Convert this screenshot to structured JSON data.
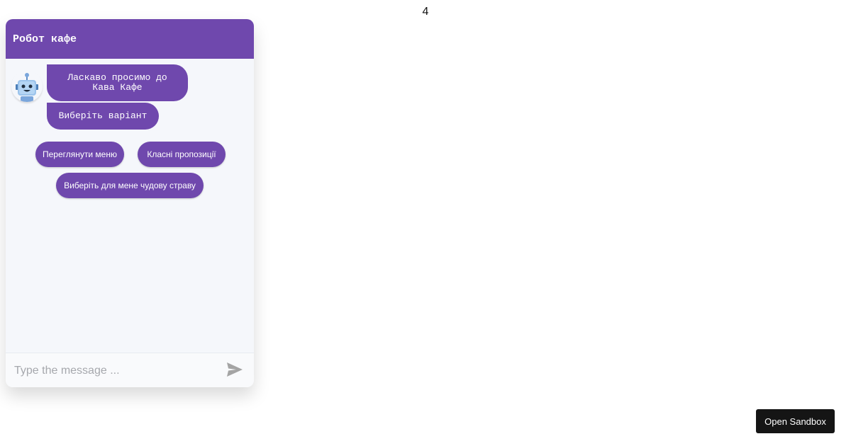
{
  "page": {
    "counter": "4"
  },
  "chat": {
    "title": "Робот кафе",
    "messages": [
      {
        "sender": "bot",
        "text": "Ласкаво просимо до Кава Кафе"
      },
      {
        "sender": "bot",
        "text": "Виберіть варіант"
      }
    ],
    "options": [
      {
        "label": "Переглянути меню"
      },
      {
        "label": "Класні пропозиції"
      },
      {
        "label": "Виберіть для мене чудову страву"
      }
    ],
    "input": {
      "value": "",
      "placeholder": "Type the message ..."
    },
    "send_icon": "send-icon",
    "avatar_icon": "robot-icon"
  },
  "sandbox": {
    "label": "Open Sandbox"
  },
  "colors": {
    "accent": "#6f48ad",
    "chat_background": "#f5f7fb",
    "sandbox_button": "#151515",
    "send_icon": "#a4a4a4"
  }
}
